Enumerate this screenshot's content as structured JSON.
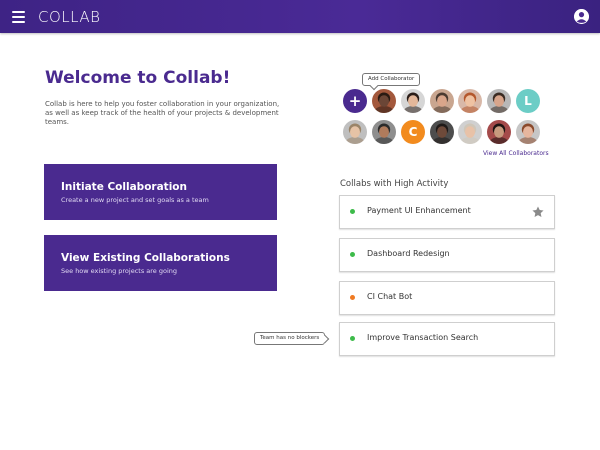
{
  "app": {
    "brand": "COLLAB"
  },
  "header": {
    "menu_icon": "hamburger-icon",
    "profile_icon": "user-circle-icon"
  },
  "welcome": {
    "title": "Welcome to Collab!",
    "text": "Collab is here to help you foster collaboration in your organization, as well as keep track of the health of your projects & development teams."
  },
  "actions": [
    {
      "title": "Initiate Collaboration",
      "subtitle": "Create a new project and set goals as a team"
    },
    {
      "title": "View Existing Collaborations",
      "subtitle": "See how existing projects are going"
    }
  ],
  "collaborators": {
    "tooltip": "Add Collaborator",
    "add_symbol": "+",
    "view_all": "View All Collaborators",
    "avatars": [
      {
        "type": "photo",
        "skin": "#6b4636",
        "hair": "#2a1a12",
        "bg": "#a3583c"
      },
      {
        "type": "photo",
        "skin": "#e3b79a",
        "hair": "#2a1d18",
        "bg": "#d6d6d6"
      },
      {
        "type": "photo",
        "skin": "#d9a58a",
        "hair": "#4a3a30",
        "bg": "#c9a690"
      },
      {
        "type": "photo",
        "skin": "#efc2a2",
        "hair": "#b4572c",
        "bg": "#d8b8a8"
      },
      {
        "type": "photo",
        "skin": "#d8a58b",
        "hair": "#3a2b22",
        "bg": "#b8b8b8"
      },
      {
        "type": "letter",
        "letter": "L",
        "color": "#6ccdc6"
      },
      {
        "type": "photo",
        "skin": "#e6c3a6",
        "hair": "#9a8468",
        "bg": "#bfbfbf"
      },
      {
        "type": "photo",
        "skin": "#b07b5c",
        "hair": "#2b2b2b",
        "bg": "#8e8e8e"
      },
      {
        "type": "letter",
        "letter": "C",
        "color": "#f28b1e"
      },
      {
        "type": "photo",
        "skin": "#6e4a3a",
        "hair": "#1f1a18",
        "bg": "#4d4d4d"
      },
      {
        "type": "photo",
        "skin": "#e8c2a8",
        "hair": "#cfc6b8",
        "bg": "#d0d0d0"
      },
      {
        "type": "photo",
        "skin": "#c89a7e",
        "hair": "#1e1412",
        "bg": "#a44a4a"
      },
      {
        "type": "photo",
        "skin": "#e6b69e",
        "hair": "#8a4a2c",
        "bg": "#c6c6c6"
      }
    ]
  },
  "collabs": {
    "heading": "Collabs with High Activity",
    "items": [
      {
        "name": "Payment UI Enhancement",
        "status_color": "#3dbb4a",
        "starred": true
      },
      {
        "name": "Dashboard Redesign",
        "status_color": "#3dbb4a",
        "starred": false
      },
      {
        "name": "CI Chat Bot",
        "status_color": "#ef7a22",
        "starred": false
      },
      {
        "name": "Improve Transaction Search",
        "status_color": "#3dbb4a",
        "starred": false
      }
    ],
    "tooltip": "Team has no blockers"
  },
  "colors": {
    "primary": "#4a2a8f",
    "green": "#3dbb4a",
    "orange": "#ef7a22",
    "star": "#8a8a8a"
  }
}
